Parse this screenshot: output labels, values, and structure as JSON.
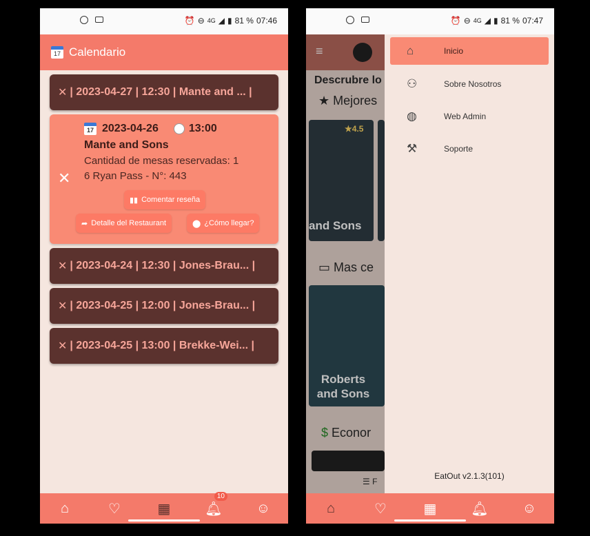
{
  "left": {
    "status": {
      "time": "07:46",
      "battery": "81 %",
      "network": "4G"
    },
    "title": "Calendario",
    "reservations": [
      {
        "text": "| 2023-04-27 | 12:30 | Mante and ... |"
      },
      {
        "date": "2023-04-26",
        "time": "13:00",
        "name": "Mante and Sons",
        "tables": "Cantidad de mesas reservadas: 1",
        "address": "6 Ryan Pass - N°: 443",
        "btn_review": "Comentar reseña",
        "btn_detail": "Detalle del Restaurant",
        "btn_directions": "¿Cómo llegar?"
      },
      {
        "text": "| 2023-04-24 | 12:30 | Jones-Brau... |"
      },
      {
        "text": "| 2023-04-25 | 12:00 | Jones-Brau... |"
      },
      {
        "text": "| 2023-04-25 | 13:00 | Brekke-Wei... |"
      }
    ],
    "nav": {
      "notif_count": "10"
    }
  },
  "right": {
    "status": {
      "time": "07:47",
      "battery": "81 %",
      "network": "4G"
    },
    "bg": {
      "discover": "Descrubre lo",
      "best": "Mejores",
      "rating": "4.5",
      "card1": "and Sons",
      "near": "Mas ce",
      "card2": "Roberts and Sons",
      "cheap": "Econor",
      "filter": "F"
    },
    "menu": [
      {
        "label": "Inicio",
        "icon": "home-icon"
      },
      {
        "label": "Sobre Nosotros",
        "icon": "people-icon"
      },
      {
        "label": "Web Admin",
        "icon": "globe-icon"
      },
      {
        "label": "Soporte",
        "icon": "tools-icon"
      }
    ],
    "version": "EatOut v2.1.3(101)"
  },
  "colors": {
    "primary": "#f47a6a",
    "dark_card": "#5b322e",
    "highlight": "#f98a74",
    "bg": "#f5e6df"
  }
}
